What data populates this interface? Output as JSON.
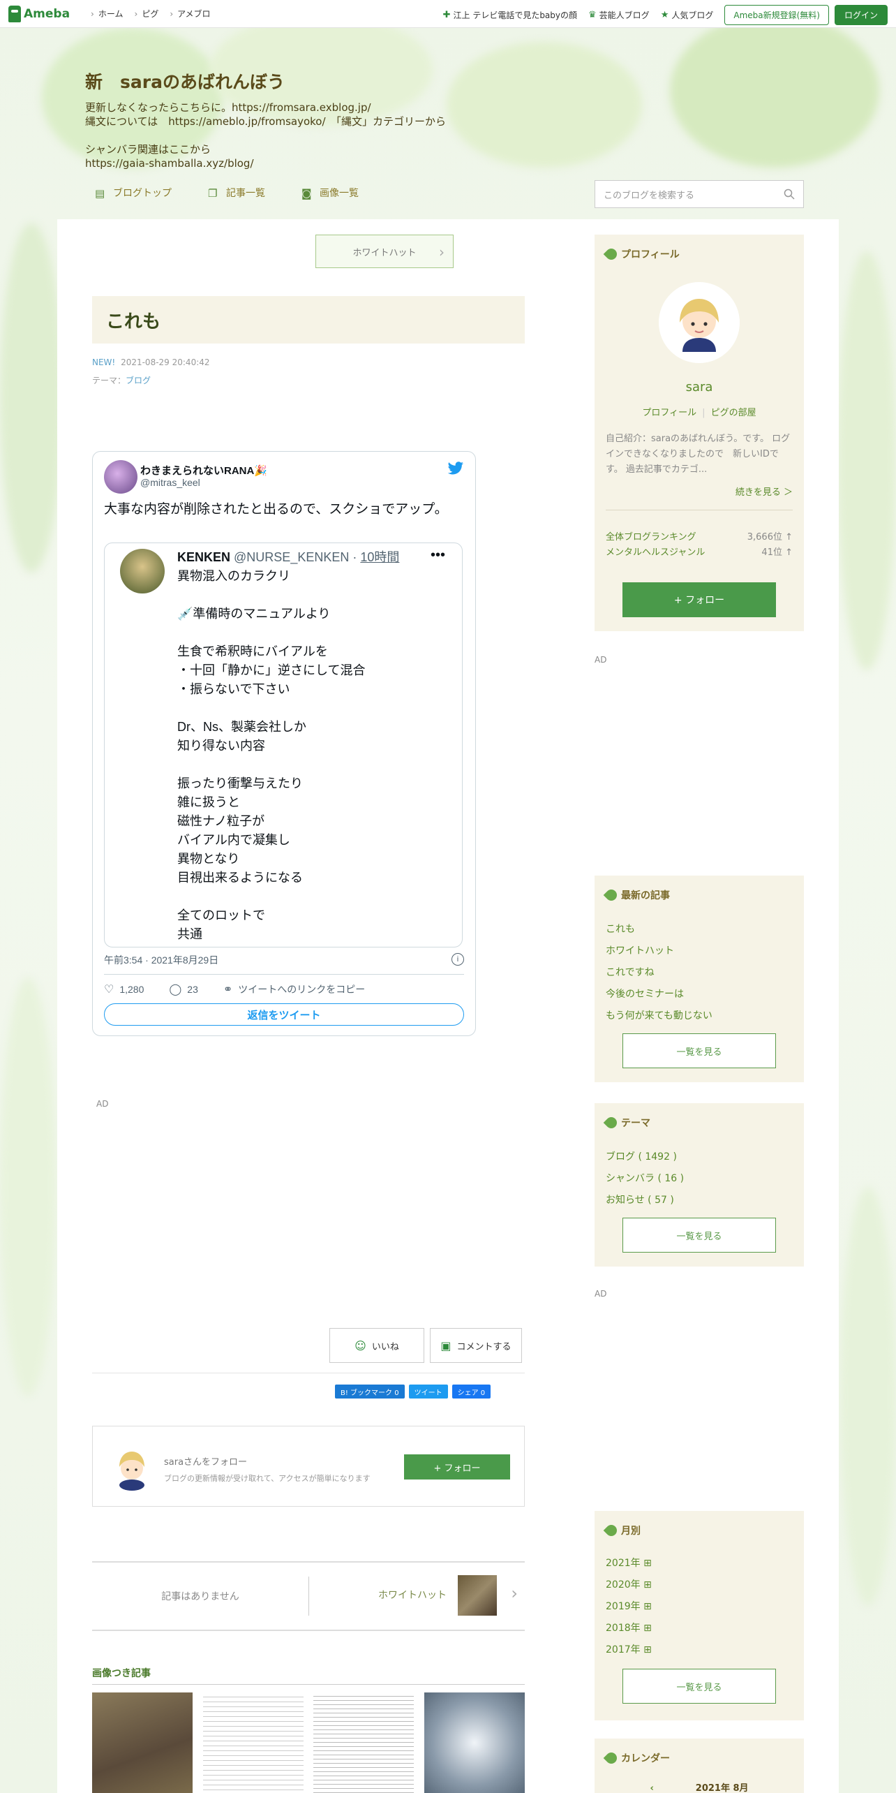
{
  "topbar": {
    "logo": "Ameba",
    "nav": [
      "ホーム",
      "ピグ",
      "アメブロ"
    ],
    "right_links": [
      "江上 テレビ電話で見たbabyの顔",
      "芸能人ブログ",
      "人気ブログ"
    ],
    "register": "Ameba新規登録(無料)",
    "login": "ログイン"
  },
  "blog": {
    "title": "新　saraのあばれんぼう",
    "description": "更新しなくなったらこちらに。https://fromsara.exblog.jp/\n縄文については　https://ameblo.jp/fromsayoko/　「縄文」カテゴリーから\n\nシャンバラ関連はここから\nhttps://gaia-shamballa.xyz/blog/",
    "nav": [
      "ブログトップ",
      "記事一覧",
      "画像一覧"
    ],
    "search_placeholder": "このブログを検索する"
  },
  "entry": {
    "prev_top": "ホワイトハット",
    "title": "これも",
    "new_label": "NEW!",
    "datetime": "2021-08-29 20:40:42",
    "theme_prefix": "テーマ：",
    "theme": "ブログ"
  },
  "tweet": {
    "name": "わきまえられないRANA🎉",
    "handle": "@mitras_keel",
    "text": "大事な内容が削除されたと出るので、スクショでアップ。",
    "quote": {
      "name": "KENKEN",
      "handle": "@NURSE_KENKEN",
      "dot": "·",
      "time": "10時間",
      "body": "異物混入のカラクリ\n\n💉準備時のマニュアルより\n\n生食で希釈時にバイアルを\n・十回「静かに」逆さにして混合\n・振らないで下さい\n\nDr、Ns、製薬会社しか\n知り得ない内容\n\n振ったり衝撃与えたり\n雑に扱うと\n磁性ナノ粒子が\nバイアル内で凝集し\n異物となり\n目視出来るようになる\n\n全てのロットで\n共通"
    },
    "date": "午前3:54 · 2021年8月29日",
    "likes": "1,280",
    "replies": "23",
    "copy_link": "ツイートへのリンクをコピー",
    "reply_button": "返信をツイート"
  },
  "ads": {
    "label": "AD"
  },
  "reactions": {
    "like": "いいね",
    "comment": "コメントする"
  },
  "share": {
    "hatena": "B! ブックマーク  0",
    "tweet": "ツイート",
    "facebook": "シェア 0"
  },
  "follow_card": {
    "title": "saraさんをフォロー",
    "sub": "ブログの更新情報が受け取れて、アクセスが簡単になります",
    "button": "+ フォロー"
  },
  "pager": {
    "prev": "記事はありません",
    "next": "ホワイトハット"
  },
  "image_section": {
    "title": "画像つき記事"
  },
  "sidebar": {
    "profile": {
      "heading": "プロフィール",
      "name": "sara",
      "link1": "プロフィール",
      "link2": "ピグの部屋",
      "intro": "自己紹介：saraのあばれんぼう。です。 ログインできなくなりましたので　新しいIDです。 過去記事でカテゴ...",
      "more": "続きを見る ＞",
      "rank1_label": "全体ブログランキング",
      "rank1_value": "3,666位 ↑",
      "rank2_label": "メンタルヘルスジャンル",
      "rank2_value": "41位 ↑",
      "follow": "+ フォロー"
    },
    "latest": {
      "heading": "最新の記事",
      "items": [
        "これも",
        "ホワイトハット",
        "これですね",
        "今後のセミナーは",
        "もう何が来ても動じない"
      ],
      "button": "一覧を見る"
    },
    "theme": {
      "heading": "テーマ",
      "items": [
        "ブログ ( 1492 )",
        "シャンバラ ( 16 )",
        "お知らせ ( 57 )"
      ],
      "button": "一覧を見る"
    },
    "monthly": {
      "heading": "月別",
      "items": [
        "2021年",
        "2020年",
        "2019年",
        "2018年",
        "2017年"
      ],
      "button": "一覧を見る"
    },
    "calendar": {
      "heading": "カレンダー",
      "month": "2021年 8月"
    }
  },
  "colors": {
    "accent": "#2d8a3a",
    "link": "#5a8a2a",
    "box_bg": "#f6f3e6",
    "twitter": "#1d9bf0"
  }
}
